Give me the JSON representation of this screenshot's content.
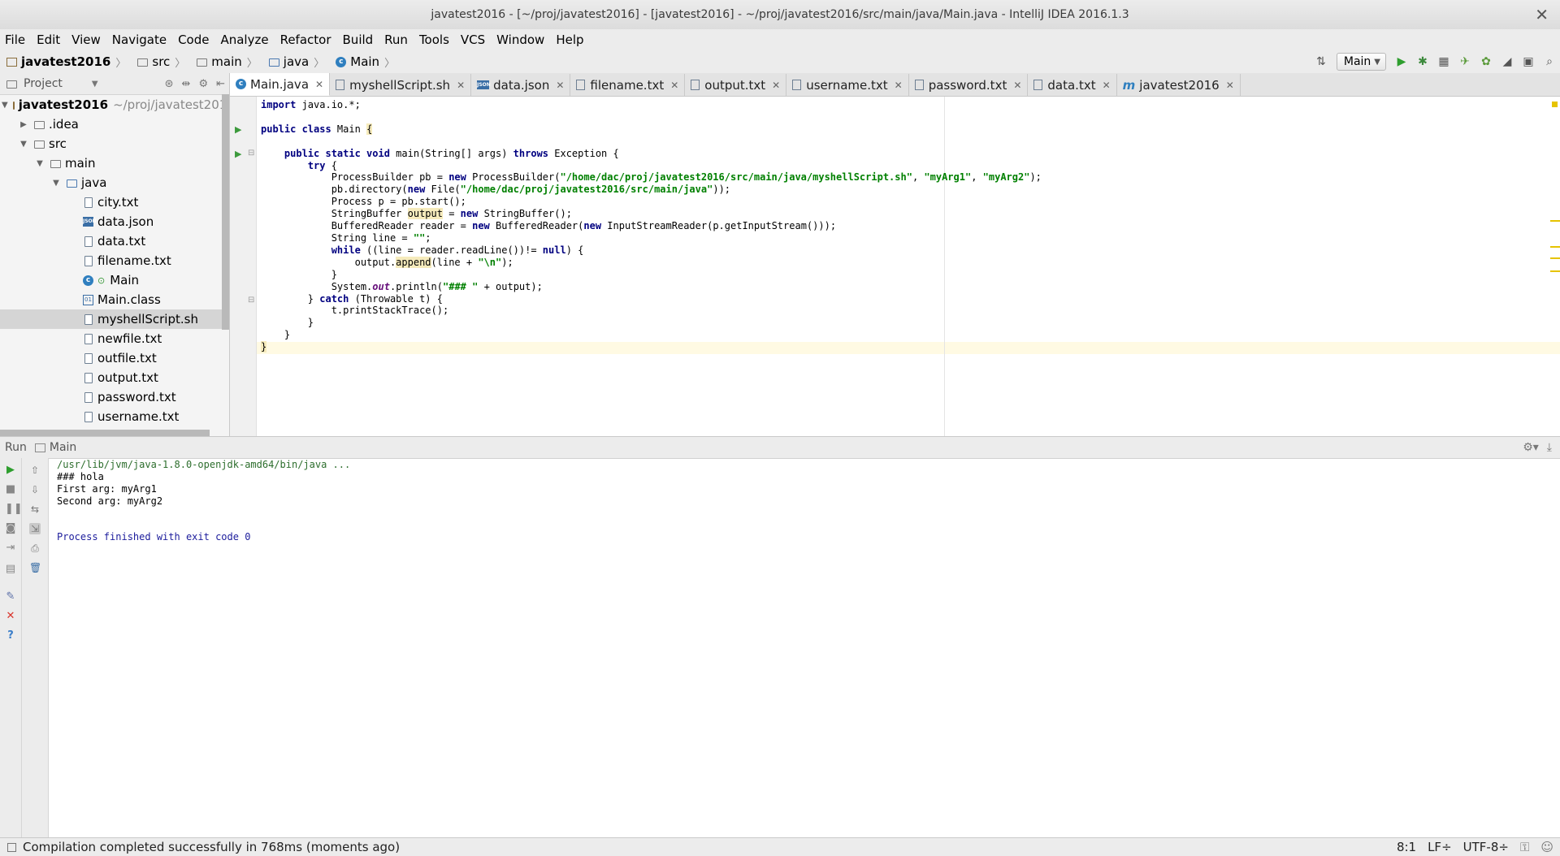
{
  "window": {
    "title": "javatest2016 - [~/proj/javatest2016] - [javatest2016] - ~/proj/javatest2016/src/main/java/Main.java - IntelliJ IDEA 2016.1.3"
  },
  "menu": [
    "File",
    "Edit",
    "View",
    "Navigate",
    "Code",
    "Analyze",
    "Refactor",
    "Build",
    "Run",
    "Tools",
    "VCS",
    "Window",
    "Help"
  ],
  "breadcrumb": [
    "javatest2016",
    "src",
    "main",
    "java",
    "Main"
  ],
  "run_config": "Main",
  "project_panel": {
    "title": "Project",
    "root": "javatest2016",
    "root_path": "~/proj/javatest2016",
    "items": [
      ".idea",
      "src",
      "main",
      "java",
      "city.txt",
      "data.json",
      "data.txt",
      "filename.txt",
      "Main",
      "Main.class",
      "myshellScript.sh",
      "newfile.txt",
      "outfile.txt",
      "output.txt",
      "password.txt",
      "username.txt"
    ]
  },
  "tabs": [
    "Main.java",
    "myshellScript.sh",
    "data.json",
    "filename.txt",
    "output.txt",
    "username.txt",
    "password.txt",
    "data.txt",
    "javatest2016"
  ],
  "run_panel": {
    "label": "Run",
    "tab": "Main",
    "console": [
      "/usr/lib/jvm/java-1.8.0-openjdk-amd64/bin/java ...",
      "### hola",
      "First arg: myArg1",
      "Second arg: myArg2",
      "Process finished with exit code 0"
    ]
  },
  "status": {
    "message": "Compilation completed successfully in 768ms (moments ago)",
    "position": "8:1",
    "line_sep": "LF÷",
    "encoding": "UTF-8÷"
  }
}
